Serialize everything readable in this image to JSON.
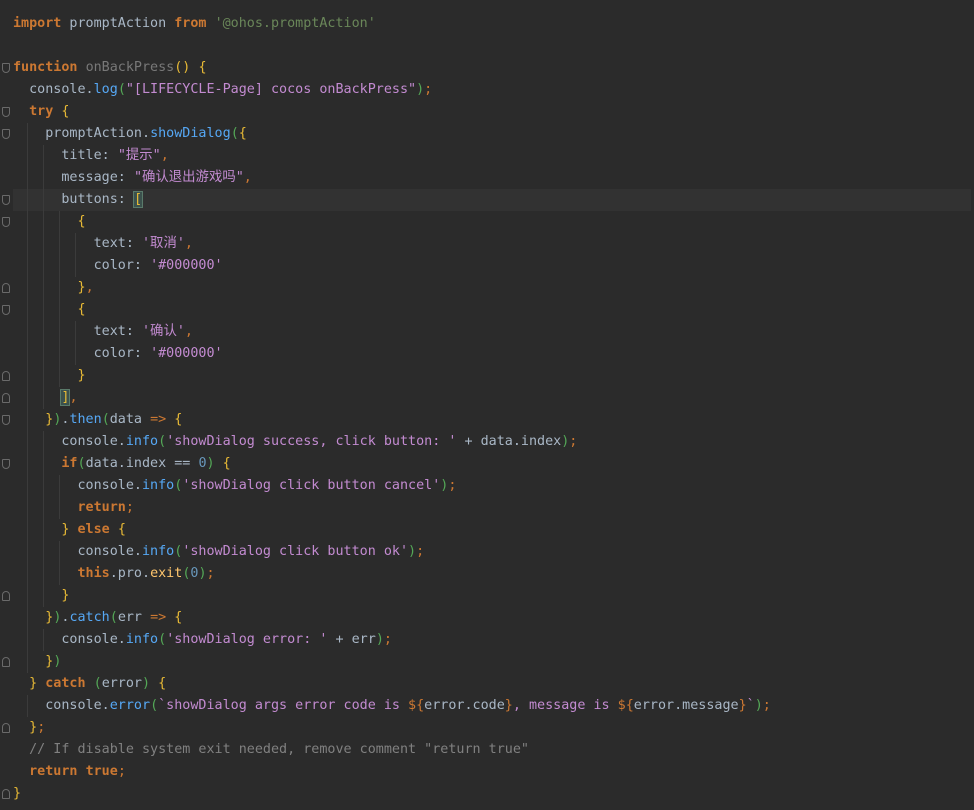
{
  "editor": {
    "language": "ArkTS",
    "theme": "dark",
    "current_line": 9,
    "lines": [
      {
        "n": 1,
        "fold": "",
        "guides": [],
        "segments": [
          [
            "kw",
            "import"
          ],
          [
            "ident",
            " promptAction "
          ],
          [
            "kw",
            "from"
          ],
          [
            "ident",
            " "
          ],
          [
            "str",
            "'@ohos.promptAction'"
          ]
        ]
      },
      {
        "n": 2,
        "fold": "",
        "guides": [],
        "segments": []
      },
      {
        "n": 3,
        "fold": "start",
        "guides": [],
        "segments": [
          [
            "kw",
            "function"
          ],
          [
            "ident",
            " "
          ],
          [
            "fn-unused",
            "onBackPress"
          ],
          [
            "brace",
            "()"
          ],
          [
            "ident",
            " "
          ],
          [
            "brace",
            "{"
          ]
        ]
      },
      {
        "n": 4,
        "fold": "",
        "guides": [],
        "segments": [
          [
            "ident",
            "  console."
          ],
          [
            "method",
            "log"
          ],
          [
            "paren",
            "("
          ],
          [
            "str-p",
            "\"[LIFECYCLE-Page] cocos onBackPress\""
          ],
          [
            "paren",
            ")"
          ],
          [
            "kw2",
            ";"
          ]
        ]
      },
      {
        "n": 5,
        "fold": "start",
        "guides": [],
        "segments": [
          [
            "ident",
            "  "
          ],
          [
            "kw",
            "try"
          ],
          [
            "ident",
            " "
          ],
          [
            "brace",
            "{"
          ]
        ]
      },
      {
        "n": 6,
        "fold": "start",
        "guides": [
          1
        ],
        "segments": [
          [
            "ident",
            "    promptAction."
          ],
          [
            "method",
            "showDialog"
          ],
          [
            "paren",
            "("
          ],
          [
            "brace",
            "{"
          ]
        ]
      },
      {
        "n": 7,
        "fold": "",
        "guides": [
          1,
          2
        ],
        "segments": [
          [
            "ident",
            "      title: "
          ],
          [
            "str-p",
            "\"提示\""
          ],
          [
            "kw2",
            ","
          ]
        ]
      },
      {
        "n": 8,
        "fold": "",
        "guides": [
          1,
          2
        ],
        "segments": [
          [
            "ident",
            "      message: "
          ],
          [
            "str-p",
            "\"确认退出游戏吗\""
          ],
          [
            "kw2",
            ","
          ]
        ]
      },
      {
        "n": 9,
        "fold": "start",
        "guides": [
          1,
          2
        ],
        "segments": [
          [
            "ident",
            "      buttons: "
          ],
          [
            "bracket-hl",
            "["
          ],
          [
            "caret",
            ""
          ]
        ]
      },
      {
        "n": 10,
        "fold": "start",
        "guides": [
          1,
          2,
          3
        ],
        "segments": [
          [
            "ident",
            "        "
          ],
          [
            "brace",
            "{"
          ]
        ]
      },
      {
        "n": 11,
        "fold": "",
        "guides": [
          1,
          2,
          3,
          4
        ],
        "segments": [
          [
            "ident",
            "          text: "
          ],
          [
            "str-p",
            "'取消'"
          ],
          [
            "kw2",
            ","
          ]
        ]
      },
      {
        "n": 12,
        "fold": "",
        "guides": [
          1,
          2,
          3,
          4
        ],
        "segments": [
          [
            "ident",
            "          color: "
          ],
          [
            "str-p",
            "'#000000'"
          ]
        ]
      },
      {
        "n": 13,
        "fold": "end",
        "guides": [
          1,
          2,
          3
        ],
        "segments": [
          [
            "ident",
            "        "
          ],
          [
            "brace",
            "}"
          ],
          [
            "kw2",
            ","
          ]
        ]
      },
      {
        "n": 14,
        "fold": "start",
        "guides": [
          1,
          2,
          3
        ],
        "segments": [
          [
            "ident",
            "        "
          ],
          [
            "brace",
            "{"
          ]
        ]
      },
      {
        "n": 15,
        "fold": "",
        "guides": [
          1,
          2,
          3,
          4
        ],
        "segments": [
          [
            "ident",
            "          text: "
          ],
          [
            "str-p",
            "'确认'"
          ],
          [
            "kw2",
            ","
          ]
        ]
      },
      {
        "n": 16,
        "fold": "",
        "guides": [
          1,
          2,
          3,
          4
        ],
        "segments": [
          [
            "ident",
            "          color: "
          ],
          [
            "str-p",
            "'#000000'"
          ]
        ]
      },
      {
        "n": 17,
        "fold": "end",
        "guides": [
          1,
          2,
          3
        ],
        "segments": [
          [
            "ident",
            "        "
          ],
          [
            "brace",
            "}"
          ]
        ]
      },
      {
        "n": 18,
        "fold": "end",
        "guides": [
          1,
          2
        ],
        "segments": [
          [
            "ident",
            "      "
          ],
          [
            "bracket-hl",
            "]"
          ],
          [
            "kw2",
            ","
          ]
        ]
      },
      {
        "n": 19,
        "fold": "start",
        "guides": [
          1
        ],
        "segments": [
          [
            "ident",
            "    "
          ],
          [
            "brace",
            "}"
          ],
          [
            "paren",
            ")"
          ],
          [
            "ident",
            "."
          ],
          [
            "method",
            "then"
          ],
          [
            "paren",
            "("
          ],
          [
            "ident",
            "data "
          ],
          [
            "kw2",
            "=>"
          ],
          [
            "ident",
            " "
          ],
          [
            "brace",
            "{"
          ]
        ]
      },
      {
        "n": 20,
        "fold": "",
        "guides": [
          1,
          2
        ],
        "segments": [
          [
            "ident",
            "      console."
          ],
          [
            "method",
            "info"
          ],
          [
            "paren",
            "("
          ],
          [
            "str-p",
            "'showDialog success, click button: '"
          ],
          [
            "ident",
            " + data.index"
          ],
          [
            "paren",
            ")"
          ],
          [
            "kw2",
            ";"
          ]
        ]
      },
      {
        "n": 21,
        "fold": "start",
        "guides": [
          1,
          2
        ],
        "segments": [
          [
            "ident",
            "      "
          ],
          [
            "kw",
            "if"
          ],
          [
            "paren",
            "("
          ],
          [
            "ident",
            "data.index == "
          ],
          [
            "num",
            "0"
          ],
          [
            "paren",
            ")"
          ],
          [
            "ident",
            " "
          ],
          [
            "brace",
            "{"
          ]
        ]
      },
      {
        "n": 22,
        "fold": "",
        "guides": [
          1,
          2,
          3
        ],
        "segments": [
          [
            "ident",
            "        console."
          ],
          [
            "method",
            "info"
          ],
          [
            "paren",
            "("
          ],
          [
            "str-p",
            "'showDialog click button cancel'"
          ],
          [
            "paren",
            ")"
          ],
          [
            "kw2",
            ";"
          ]
        ]
      },
      {
        "n": 23,
        "fold": "",
        "guides": [
          1,
          2,
          3
        ],
        "segments": [
          [
            "ident",
            "        "
          ],
          [
            "kw",
            "return"
          ],
          [
            "kw2",
            ";"
          ]
        ]
      },
      {
        "n": 24,
        "fold": "",
        "guides": [
          1,
          2
        ],
        "segments": [
          [
            "ident",
            "      "
          ],
          [
            "brace",
            "}"
          ],
          [
            "ident",
            " "
          ],
          [
            "kw",
            "else"
          ],
          [
            "ident",
            " "
          ],
          [
            "brace",
            "{"
          ]
        ]
      },
      {
        "n": 25,
        "fold": "",
        "guides": [
          1,
          2,
          3
        ],
        "segments": [
          [
            "ident",
            "        console."
          ],
          [
            "method",
            "info"
          ],
          [
            "paren",
            "("
          ],
          [
            "str-p",
            "'showDialog click button ok'"
          ],
          [
            "paren",
            ")"
          ],
          [
            "kw2",
            ";"
          ]
        ]
      },
      {
        "n": 26,
        "fold": "",
        "guides": [
          1,
          2,
          3
        ],
        "segments": [
          [
            "ident",
            "        "
          ],
          [
            "kw",
            "this"
          ],
          [
            "ident",
            ".pro."
          ],
          [
            "fn",
            "exit"
          ],
          [
            "paren",
            "("
          ],
          [
            "num",
            "0"
          ],
          [
            "paren",
            ")"
          ],
          [
            "kw2",
            ";"
          ]
        ]
      },
      {
        "n": 27,
        "fold": "end",
        "guides": [
          1,
          2
        ],
        "segments": [
          [
            "ident",
            "      "
          ],
          [
            "brace",
            "}"
          ]
        ]
      },
      {
        "n": 28,
        "fold": "",
        "guides": [
          1
        ],
        "segments": [
          [
            "ident",
            "    "
          ],
          [
            "brace",
            "}"
          ],
          [
            "paren",
            ")"
          ],
          [
            "ident",
            "."
          ],
          [
            "method",
            "catch"
          ],
          [
            "paren",
            "("
          ],
          [
            "ident",
            "err "
          ],
          [
            "kw2",
            "=>"
          ],
          [
            "ident",
            " "
          ],
          [
            "brace",
            "{"
          ]
        ]
      },
      {
        "n": 29,
        "fold": "",
        "guides": [
          1,
          2
        ],
        "segments": [
          [
            "ident",
            "      console."
          ],
          [
            "method",
            "info"
          ],
          [
            "paren",
            "("
          ],
          [
            "str-p",
            "'showDialog error: '"
          ],
          [
            "ident",
            " + err"
          ],
          [
            "paren",
            ")"
          ],
          [
            "kw2",
            ";"
          ]
        ]
      },
      {
        "n": 30,
        "fold": "end",
        "guides": [
          1
        ],
        "segments": [
          [
            "ident",
            "    "
          ],
          [
            "brace",
            "}"
          ],
          [
            "paren",
            ")"
          ]
        ]
      },
      {
        "n": 31,
        "fold": "",
        "guides": [],
        "segments": [
          [
            "ident",
            "  "
          ],
          [
            "brace",
            "}"
          ],
          [
            "ident",
            " "
          ],
          [
            "kw",
            "catch"
          ],
          [
            "ident",
            " "
          ],
          [
            "paren",
            "("
          ],
          [
            "ident",
            "error"
          ],
          [
            "paren",
            ")"
          ],
          [
            "ident",
            " "
          ],
          [
            "brace",
            "{"
          ]
        ]
      },
      {
        "n": 32,
        "fold": "",
        "guides": [
          1
        ],
        "segments": [
          [
            "ident",
            "    console."
          ],
          [
            "method",
            "error"
          ],
          [
            "paren",
            "("
          ],
          [
            "str-p",
            "`showDialog args error code is "
          ],
          [
            "kw2",
            "${"
          ],
          [
            "ident",
            "error.code"
          ],
          [
            "kw2",
            "}"
          ],
          [
            "str-p",
            ", message is "
          ],
          [
            "kw2",
            "${"
          ],
          [
            "ident",
            "error.message"
          ],
          [
            "kw2",
            "}"
          ],
          [
            "str-p",
            "`"
          ],
          [
            "paren",
            ")"
          ],
          [
            "kw2",
            ";"
          ]
        ]
      },
      {
        "n": 33,
        "fold": "end",
        "guides": [],
        "segments": [
          [
            "ident",
            "  "
          ],
          [
            "brace",
            "}"
          ],
          [
            "kw2",
            ";"
          ]
        ]
      },
      {
        "n": 34,
        "fold": "",
        "guides": [],
        "segments": [
          [
            "comment",
            "  // If disable system exit needed, remove comment \"return true\""
          ]
        ]
      },
      {
        "n": 35,
        "fold": "",
        "guides": [],
        "segments": [
          [
            "ident",
            "  "
          ],
          [
            "kw",
            "return"
          ],
          [
            "ident",
            " "
          ],
          [
            "kw",
            "true"
          ],
          [
            "kw2",
            ";"
          ]
        ]
      },
      {
        "n": 36,
        "fold": "end",
        "guides": [],
        "segments": [
          [
            "brace",
            "}"
          ]
        ]
      }
    ]
  }
}
